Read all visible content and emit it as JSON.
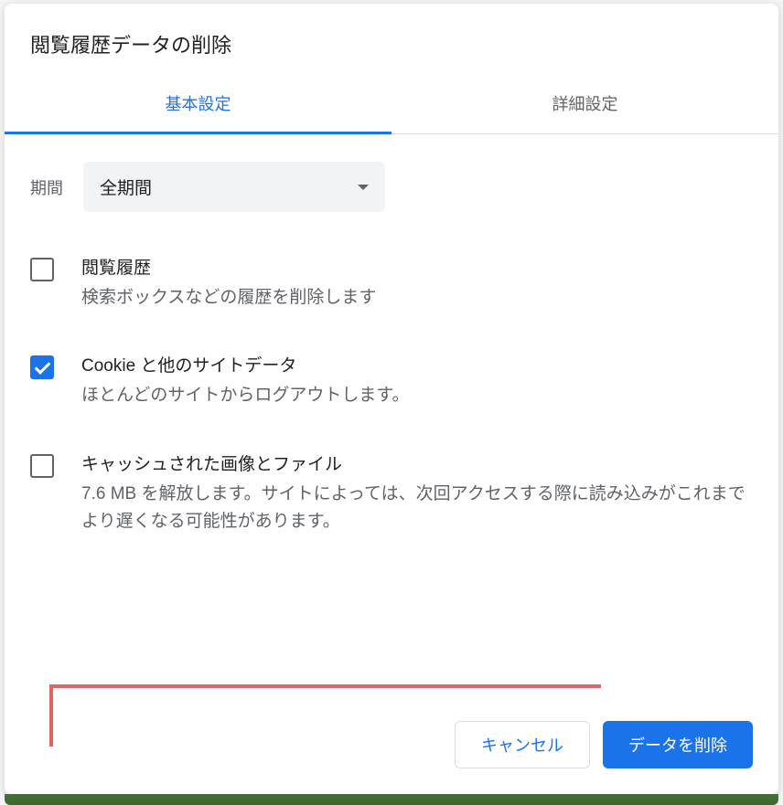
{
  "dialog": {
    "title": "閲覧履歴データの削除"
  },
  "tabs": {
    "basic": "基本設定",
    "advanced": "詳細設定"
  },
  "period": {
    "label": "期間",
    "value": "全期間"
  },
  "options": [
    {
      "title": "閲覧履歴",
      "desc": "検索ボックスなどの履歴を削除します",
      "checked": false
    },
    {
      "title": "Cookie と他のサイトデータ",
      "desc": "ほとんどのサイトからログアウトします。",
      "checked": true
    },
    {
      "title": "キャッシュされた画像とファイル",
      "desc": "7.6 MB を解放します。サイトによっては、次回アクセスする際に読み込みがこれまでより遅くなる可能性があります。",
      "checked": false
    }
  ],
  "buttons": {
    "cancel": "キャンセル",
    "delete": "データを削除"
  }
}
